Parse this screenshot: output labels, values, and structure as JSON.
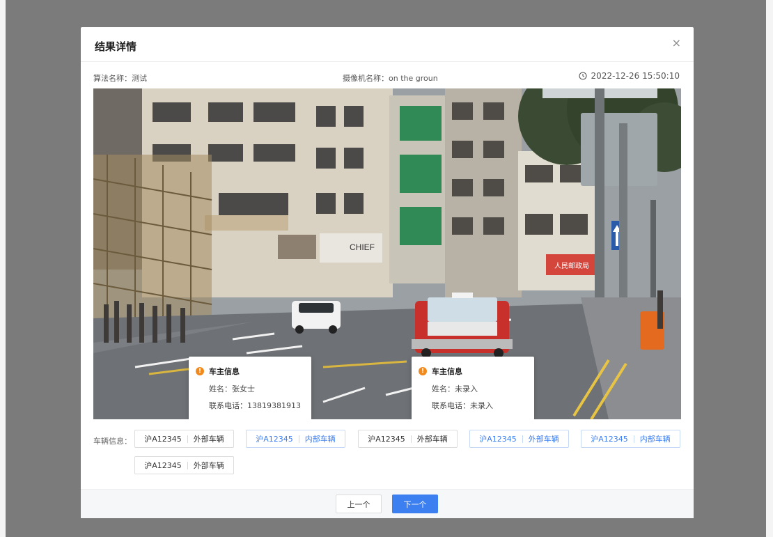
{
  "dialog": {
    "title": "结果详情",
    "close_glyph": "×"
  },
  "meta": {
    "algorithm": "算法名称：测试",
    "camera": "摄像机名称：on the groun",
    "timestamp": "2022-12-26 15:50:10"
  },
  "scene": {
    "signs": {
      "chief": "CHIEF",
      "shop": "人民邮政局"
    }
  },
  "popups": [
    {
      "heading": "车主信息",
      "name": "姓名：张女士",
      "phone": "联系电话：13819381913"
    },
    {
      "heading": "车主信息",
      "name": "姓名：未录入",
      "phone": "联系电话：未录入"
    }
  ],
  "vehicles": {
    "label": "车辆信息：",
    "items": [
      {
        "plate": "沪A12345",
        "type": "外部车辆",
        "active": false
      },
      {
        "plate": "沪A12345",
        "type": "内部车辆",
        "active": true
      },
      {
        "plate": "沪A12345",
        "type": "外部车辆",
        "active": false
      },
      {
        "plate": "沪A12345",
        "type": "外部车辆",
        "active": true
      },
      {
        "plate": "沪A12345",
        "type": "内部车辆",
        "active": true
      },
      {
        "plate": "沪A12345",
        "type": "外部车辆",
        "active": false
      }
    ]
  },
  "footer": {
    "prev_label": "上一个",
    "next_label": "下一个"
  },
  "colors": {
    "primary": "#3c7ff0",
    "warning": "#f08a1c",
    "overlay": "#7b7b7b"
  },
  "icons": [
    "close-icon",
    "clock-icon",
    "info-icon"
  ]
}
